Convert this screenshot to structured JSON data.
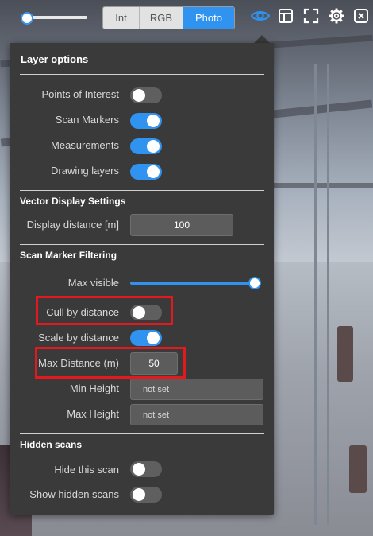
{
  "top_bar": {
    "modes": [
      {
        "label": "Int",
        "active": false
      },
      {
        "label": "RGB",
        "active": false
      },
      {
        "label": "Photo",
        "active": true
      }
    ],
    "icons": [
      "eye-icon",
      "layout-icon",
      "fullscreen-icon",
      "gear-icon",
      "close-icon"
    ],
    "accent_color": "#2f93ef"
  },
  "panel": {
    "title": "Layer options",
    "layer_toggles": [
      {
        "label": "Points of Interest",
        "on": false
      },
      {
        "label": "Scan Markers",
        "on": true
      },
      {
        "label": "Measurements",
        "on": true
      },
      {
        "label": "Drawing layers",
        "on": true
      }
    ],
    "vector": {
      "title": "Vector Display Settings",
      "display_distance_label": "Display distance [m]",
      "display_distance_value": "100"
    },
    "filtering": {
      "title": "Scan Marker Filtering",
      "max_visible_label": "Max visible",
      "max_visible_value": 1.0,
      "cull_label": "Cull by distance",
      "cull_on": false,
      "scale_label": "Scale by distance",
      "scale_on": true,
      "max_distance_label": "Max Distance (m)",
      "max_distance_value": "50",
      "min_height_label": "Min Height",
      "min_height_value": "not set",
      "max_height_label": "Max Height",
      "max_height_value": "not set"
    },
    "hidden": {
      "title": "Hidden scans",
      "hide_label": "Hide this scan",
      "hide_on": false,
      "show_label": "Show hidden scans",
      "show_on": false
    }
  },
  "highlight_color": "#e3191d"
}
